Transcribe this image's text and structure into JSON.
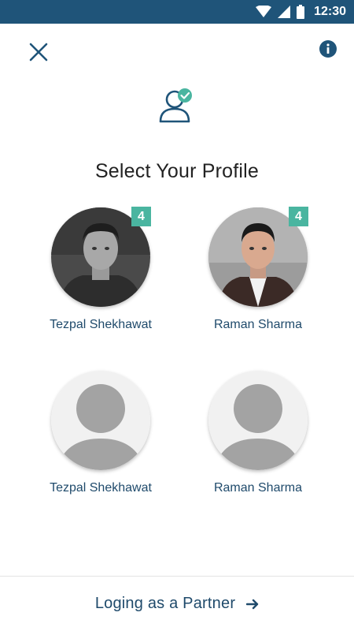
{
  "status_bar": {
    "time": "12:30"
  },
  "header": {
    "close_icon": "close-icon",
    "info_icon": "info-icon",
    "profile_icon": "user-check-icon"
  },
  "title": "Select Your Profile",
  "profiles": [
    {
      "name": "Tezpal Shekhawat",
      "badge": "4",
      "avatar": "photo"
    },
    {
      "name": "Raman Sharma",
      "badge": "4",
      "avatar": "photo"
    },
    {
      "name": "Tezpal Shekhawat",
      "avatar": "placeholder"
    },
    {
      "name": "Raman Sharma",
      "avatar": "placeholder"
    }
  ],
  "footer": {
    "partner_label": "Loging as a Partner",
    "arrow_icon": "arrow-right-icon"
  },
  "colors": {
    "status_bar": "#1f5479",
    "accent": "#1f4a6b",
    "badge": "#4ab5a0"
  }
}
